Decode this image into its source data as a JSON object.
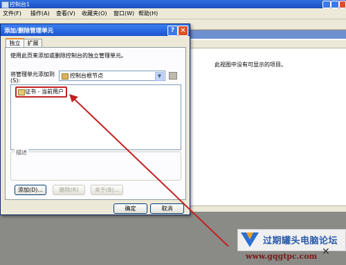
{
  "mmc": {
    "title": "控制台1",
    "menu": [
      "文件(F)",
      "操作(A)",
      "查看(V)",
      "收藏夹(O)",
      "窗口(W)",
      "帮助(H)"
    ],
    "empty_message": "此视图中没有可显示的项目。"
  },
  "dialog": {
    "title": "添加/删除管理单元",
    "help_glyph": "?",
    "close_glyph": "✕",
    "tabs": [
      "独立",
      "扩展"
    ],
    "intro": "使用此页来添加或删除控制台的独立管理单元。",
    "snapin_label": "将管理单元添加到(S):",
    "combo_value": "控制台根节点",
    "list_items": [
      "证书 - 当前用户"
    ],
    "description_label": "描述",
    "buttons": {
      "add": "添加(D)...",
      "remove": "删除(R)",
      "about": "关于(B)...",
      "ok": "确定",
      "cancel": "取消"
    }
  },
  "watermark": {
    "text": "过期罐头电脑论坛",
    "url": "www.gqgtpc.com"
  },
  "annotation": {
    "color": "#c42020"
  }
}
